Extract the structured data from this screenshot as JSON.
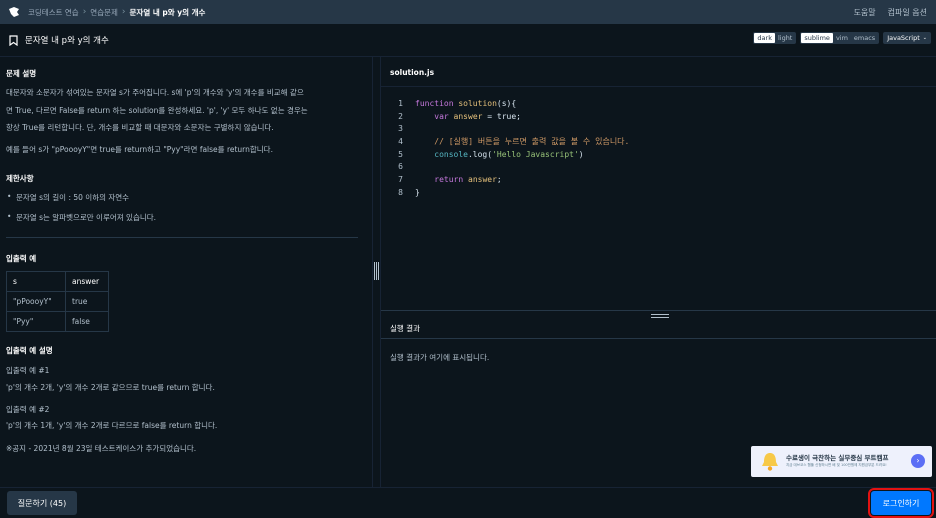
{
  "nav": {
    "breadcrumbs": [
      "코딩테스트 연습",
      "연습문제",
      "문자열 내 p와 y의 개수"
    ],
    "help_label": "도움말",
    "compile_options_label": "컴파일 옵션"
  },
  "header": {
    "title": "문자열 내 p와 y의 개수",
    "theme_options": [
      "dark",
      "light"
    ],
    "theme_selected": "dark",
    "keymap_options": [
      "sublime",
      "vim",
      "emacs"
    ],
    "keymap_selected": "sublime",
    "language_selected": "JavaScript"
  },
  "problem": {
    "desc_heading": "문제 설명",
    "desc_lines": [
      "대문자와 소문자가 섞여있는 문자열 s가 주어집니다. s에 'p'의 개수와 'y'의 개수를 비교해 같으",
      "면 True, 다르면 False를 return 하는 solution를 완성하세요. 'p', 'y' 모두 하나도 없는 경우는",
      "항상 True를 리턴합니다. 단, 개수를 비교할 때 대문자와 소문자는 구별하지 않습니다."
    ],
    "example_text": "예를 들어 s가 \"pPoooyY\"면 true를 return하고 \"Pyy\"라면 false를 return합니다.",
    "constraints_heading": "제한사항",
    "constraints": [
      "문자열 s의 길이 : 50 이하의 자연수",
      "문자열 s는 알파벳으로만 이루어져 있습니다."
    ],
    "io_heading": "입출력 예",
    "io_table": {
      "headers": [
        "s",
        "answer"
      ],
      "rows": [
        [
          "\"pPoooyY\"",
          "true"
        ],
        [
          "\"Pyy\"",
          "false"
        ]
      ]
    },
    "io_desc_heading": "입출력 예 설명",
    "io_desc": [
      "입출력 예 #1",
      "'p'의 개수 2개, 'y'의 개수 2개로 같으므로 true를 return 합니다.",
      "입출력 예 #2",
      "'p'의 개수 1개, 'y'의 개수 2개로 다르므로 false를 return 합니다."
    ],
    "notice": "※공지 - 2021년 8월 23일 테스트케이스가 추가되었습니다."
  },
  "editor": {
    "filename": "solution.js",
    "line_numbers": [
      "1",
      "2",
      "3",
      "4",
      "5",
      "6",
      "7",
      "8"
    ],
    "code": {
      "l1_kw": "function",
      "l1_fn": "solution",
      "l1_rest": "(s){",
      "l2_kw": "var",
      "l2_var": "answer",
      "l2_rest": " = true;",
      "l4_comment": "// [실행] 버튼을 누르면 출력 값을 볼 수 있습니다.",
      "l5_obj": "console",
      "l5_method": ".log(",
      "l5_str": "'Hello Javascript'",
      "l5_end": ")",
      "l7_kw": "return",
      "l7_var": "answer",
      "l7_end": ";",
      "l8": "}"
    }
  },
  "result": {
    "title": "실행 결과",
    "placeholder": "실행 결과가 여기에 표시됩니다."
  },
  "ad": {
    "title": "수료생이 극찬하는 실무중심 부트캠프",
    "subtitle": "지금 데브코스 웹풀 신청하시면 배 및 100만원에 지원금부분 드려요!"
  },
  "footer": {
    "ask_button": "질문하기 (45)",
    "login_button": "로그인하기"
  },
  "colors": {
    "background": "#0c151c",
    "nav": "#263747",
    "primary": "#0078ff",
    "highlight": "#e31212"
  }
}
